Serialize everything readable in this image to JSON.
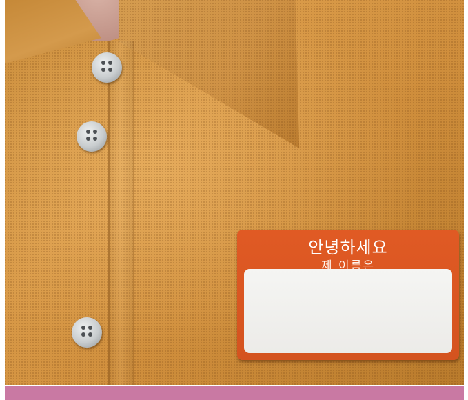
{
  "badge": {
    "greeting": "안녕하세요",
    "subtitle": "제 이름은"
  },
  "colors": {
    "shirt": "#cf8e3c",
    "badge": "#e05a24",
    "footer_bar": "#c979a3"
  }
}
